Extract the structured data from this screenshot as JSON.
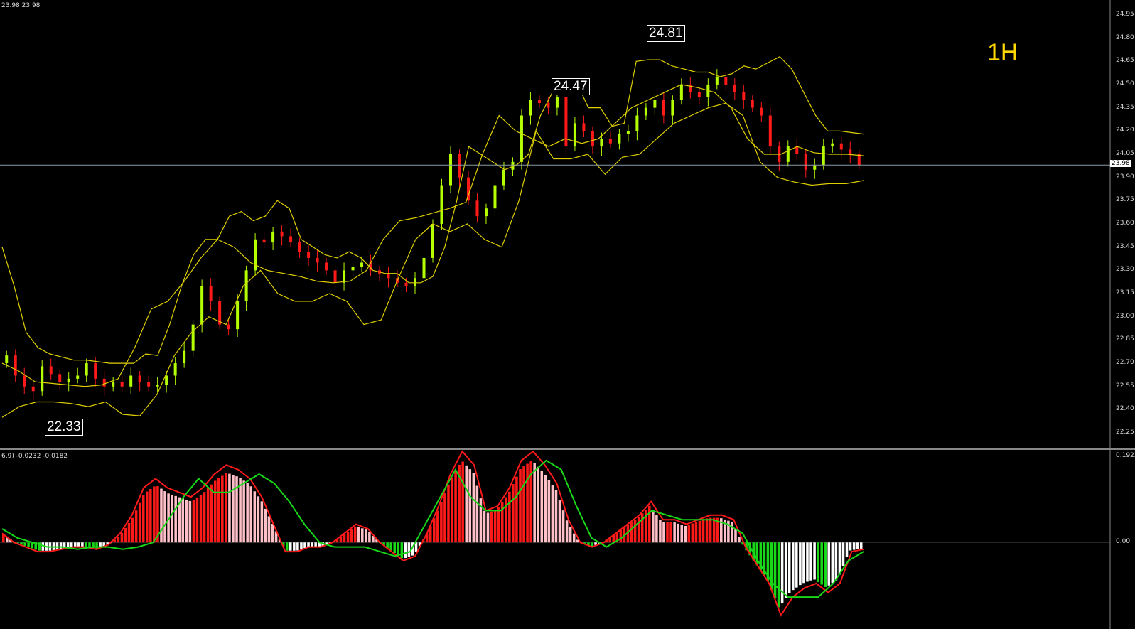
{
  "header": {
    "ohlc_text": "23.98 23.98",
    "macd_text": "6,9) -0.0232 -0.0182",
    "timeframe": "1H"
  },
  "price_labels": {
    "low": "22.33",
    "mid": "24.47",
    "high": "24.81",
    "current": "23.98"
  },
  "axis": {
    "price_ticks": [
      "24.95",
      "24.80",
      "24.65",
      "24.50",
      "24.35",
      "24.20",
      "24.05",
      "23.90",
      "23.75",
      "23.60",
      "23.45",
      "23.30",
      "23.15",
      "23.00",
      "22.85",
      "22.70",
      "22.55",
      "22.40",
      "22.25"
    ],
    "macd_ticks": [
      "0.1923",
      "0.00"
    ]
  },
  "colors": {
    "bull": "#b4ff00",
    "bear": "#ff1a1a",
    "band": "#e0d000",
    "macd_line": "#ff1a1a",
    "signal_line": "#18d818",
    "hist_pos": "#ff1a1a",
    "hist_pos_light": "#ffc0c8",
    "hist_neg": "#18d818",
    "hist_neg_light": "#ffffff"
  },
  "chart_data": [
    {
      "type": "candlestick",
      "title": "",
      "ylim": [
        22.2,
        25.0
      ],
      "current_price": 23.98,
      "labels": [
        {
          "value": 22.33
        },
        {
          "value": 24.47
        },
        {
          "value": 24.81
        }
      ],
      "series": [
        {
          "role": "close",
          "values": [
            22.75,
            22.62,
            22.55,
            22.52,
            22.68,
            22.63,
            22.58,
            22.6,
            22.62,
            22.7,
            22.6,
            22.55,
            22.58,
            22.55,
            22.62,
            22.58,
            22.55,
            22.56,
            22.62,
            22.7,
            22.78,
            22.95,
            23.2,
            23.1,
            22.95,
            22.92,
            23.1,
            23.3,
            23.5,
            23.48,
            23.55,
            23.52,
            23.48,
            23.42,
            23.38,
            23.35,
            23.3,
            23.22,
            23.3,
            23.32,
            23.35,
            23.3,
            23.28,
            23.25,
            23.22,
            23.2,
            23.25,
            23.38,
            23.6,
            23.85,
            24.05,
            23.9,
            23.75,
            23.65,
            23.7,
            23.85,
            23.95,
            24.0,
            24.3,
            24.4,
            24.38,
            24.35,
            24.42,
            24.1,
            24.25,
            24.2,
            24.1,
            24.15,
            24.12,
            24.18,
            24.2,
            24.3,
            24.35,
            24.4,
            24.3,
            24.4,
            24.5,
            24.45,
            24.42,
            24.5,
            24.55,
            24.5,
            24.45,
            24.4,
            24.35,
            24.3,
            24.1,
            24.0,
            24.1,
            24.05,
            23.95,
            23.98,
            24.1,
            24.12,
            24.08,
            24.05,
            23.98
          ]
        },
        {
          "role": "bollinger_upper",
          "values": [
            23.45,
            23.2,
            22.9,
            22.8,
            22.76,
            22.74,
            22.72,
            22.72,
            22.71,
            22.7,
            22.7,
            22.7,
            22.76,
            22.75,
            22.95,
            23.2,
            23.4,
            23.5,
            23.5,
            23.65,
            23.68,
            23.62,
            23.65,
            23.75,
            23.7,
            23.5,
            23.45,
            23.4,
            23.38,
            23.42,
            23.38,
            23.3,
            23.28,
            23.28,
            23.22,
            23.22,
            23.26,
            23.45,
            23.75,
            24.1,
            24.05,
            24.0,
            23.95,
            23.98,
            24.05,
            24.3,
            24.45,
            24.5,
            24.52,
            24.35,
            24.35,
            24.23,
            24.25,
            24.65,
            24.66,
            24.66,
            24.62,
            24.6,
            24.58,
            24.58,
            24.55,
            24.57,
            24.62,
            24.6,
            24.64,
            24.68,
            24.6,
            24.45,
            24.3,
            24.2,
            24.2,
            24.19,
            24.18
          ]
        },
        {
          "role": "bollinger_middle",
          "values": [
            22.7,
            22.65,
            22.58,
            22.57,
            22.56,
            22.55,
            22.56,
            22.6,
            22.8,
            23.05,
            23.1,
            23.23,
            23.38,
            23.5,
            23.45,
            23.35,
            23.3,
            23.28,
            23.26,
            23.23,
            23.22,
            23.23,
            23.3,
            23.5,
            23.62,
            23.64,
            23.67,
            23.7,
            23.74,
            24.05,
            24.3,
            24.2,
            24.15,
            24.1,
            24.15,
            24.12,
            24.15,
            24.25,
            24.35,
            24.4,
            24.45,
            24.5,
            24.48,
            24.45,
            24.35,
            24.15,
            24.05,
            24.05,
            24.1,
            24.06,
            24.05,
            24.05,
            24.04
          ]
        },
        {
          "role": "bollinger_lower",
          "values": [
            22.35,
            22.42,
            22.45,
            22.45,
            22.44,
            22.42,
            22.45,
            22.37,
            22.36,
            22.5,
            22.75,
            22.9,
            23.0,
            22.95,
            23.2,
            23.3,
            23.15,
            23.1,
            23.1,
            23.15,
            23.1,
            22.95,
            22.98,
            23.25,
            23.5,
            23.6,
            23.55,
            23.6,
            23.5,
            23.45,
            23.75,
            24.2,
            24.02,
            24.02,
            24.05,
            23.92,
            24.03,
            24.05,
            24.15,
            24.25,
            24.3,
            24.35,
            24.38,
            24.3,
            24.0,
            23.9,
            23.87,
            23.85,
            23.86,
            23.86,
            23.88
          ]
        }
      ]
    },
    {
      "type": "macd",
      "ylim": [
        -0.19,
        0.1923
      ],
      "values": {
        "macd": -0.0232,
        "signal": -0.0182
      },
      "series": [
        {
          "name": "macd",
          "values": [
            0.02,
            0.0,
            -0.01,
            -0.02,
            -0.02,
            -0.015,
            -0.01,
            -0.01,
            -0.015,
            -0.005,
            0.02,
            0.06,
            0.12,
            0.14,
            0.12,
            0.11,
            0.1,
            0.12,
            0.15,
            0.17,
            0.16,
            0.14,
            0.1,
            0.04,
            -0.02,
            -0.02,
            -0.01,
            -0.01,
            0.0,
            0.02,
            0.04,
            0.03,
            0.0,
            -0.02,
            -0.04,
            -0.03,
            0.02,
            0.08,
            0.15,
            0.2,
            0.17,
            0.07,
            0.08,
            0.12,
            0.18,
            0.2,
            0.17,
            0.13,
            0.05,
            0.0,
            -0.01,
            0.0,
            0.02,
            0.04,
            0.06,
            0.09,
            0.05,
            0.05,
            0.04,
            0.05,
            0.06,
            0.06,
            0.05,
            -0.01,
            -0.05,
            -0.09,
            -0.16,
            -0.12,
            -0.1,
            -0.09,
            -0.11,
            -0.09,
            -0.02,
            -0.015
          ]
        },
        {
          "name": "signal",
          "values": [
            0.03,
            0.01,
            0.0,
            -0.01,
            -0.01,
            -0.015,
            -0.01,
            -0.01,
            -0.015,
            -0.01,
            0.0,
            0.05,
            0.1,
            0.14,
            0.11,
            0.11,
            0.13,
            0.15,
            0.13,
            0.09,
            0.04,
            0.0,
            -0.01,
            -0.01,
            -0.01,
            -0.02,
            -0.03,
            -0.02,
            0.04,
            0.1,
            0.16,
            0.1,
            0.07,
            0.07,
            0.1,
            0.15,
            0.18,
            0.16,
            0.08,
            0.01,
            -0.01,
            0.01,
            0.04,
            0.07,
            0.06,
            0.05,
            0.05,
            0.05,
            0.04,
            0.02,
            -0.04,
            -0.09,
            -0.12,
            -0.12,
            -0.12,
            -0.09,
            -0.04,
            -0.02
          ]
        }
      ]
    }
  ]
}
